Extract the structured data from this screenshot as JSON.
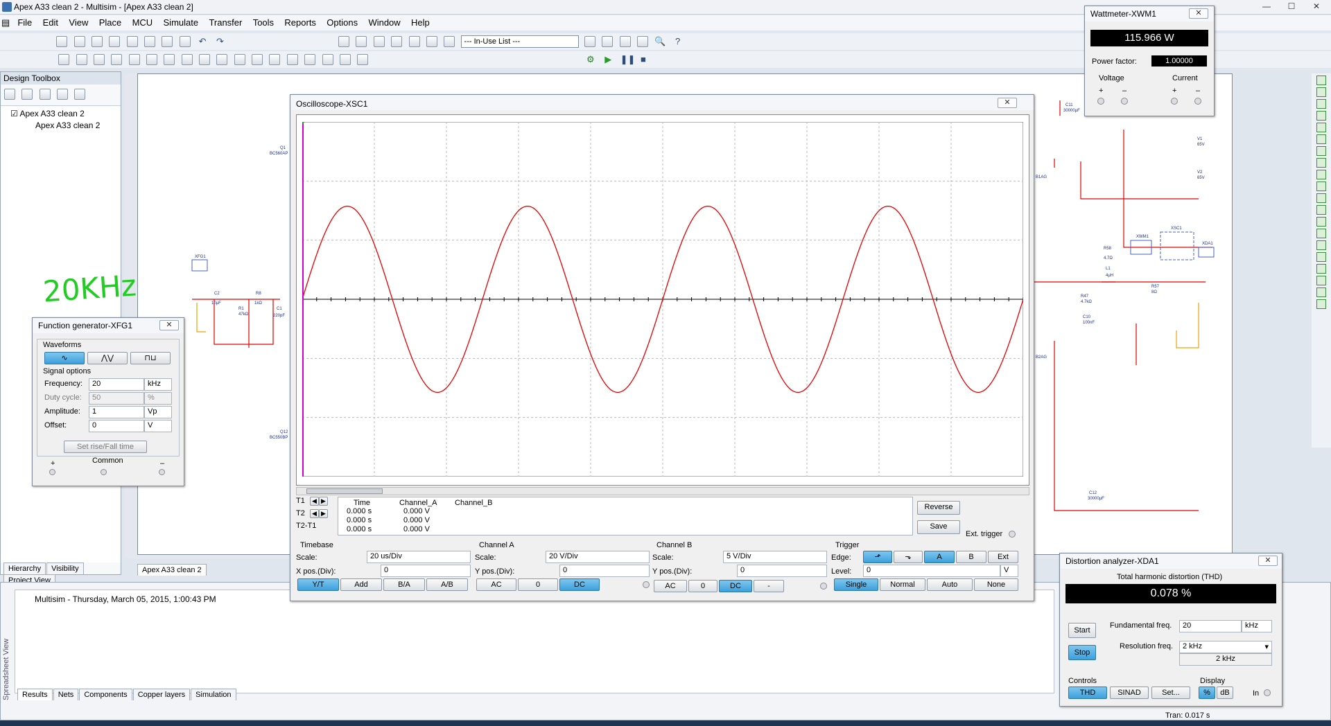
{
  "app": {
    "title": "Apex A33 clean 2 - Multisim - [Apex A33 clean 2]"
  },
  "menu": [
    "File",
    "Edit",
    "View",
    "Place",
    "MCU",
    "Simulate",
    "Transfer",
    "Tools",
    "Reports",
    "Options",
    "Window",
    "Help"
  ],
  "toolbar": {
    "in_use_list": "--- In-Use List ---"
  },
  "design_toolbox": {
    "title": "Design Toolbox",
    "root": "Apex A33 clean 2",
    "child": "Apex A33 clean 2",
    "tabs": [
      "Hierarchy",
      "Visibility",
      "Project View"
    ]
  },
  "document_tab": "Apex A33 clean 2",
  "annotation": "20KHz",
  "schematic_labels": {
    "q1": "Q1",
    "q1_type": "BC560AP",
    "q12": "Q12",
    "q12_type": "BC550BP",
    "xfg1": "XFG1",
    "c2": "C2",
    "c2_val": "10µF",
    "r1": "R1",
    "r1_val": "47kΩ",
    "r8": "R8",
    "r8_val": "1kΩ",
    "c1": "C1",
    "c1_val": "220pF",
    "c11": "C11",
    "c11_val": "30000µF",
    "v1": "V1",
    "v1_val": "65V",
    "v2": "V2",
    "v2_val": "65V",
    "net_a": "B1AG",
    "net_b": "B2AG",
    "r58": "R58",
    "r58_val": "4.7Ω",
    "l1": "L1",
    "l1_val": "4µH",
    "r47": "R47",
    "r47_val": "4.7kΩ",
    "c10": "C10",
    "c10_val": "100nF",
    "r57": "R57",
    "r57_val": "8Ω",
    "xwm1": "XWM1",
    "xsc1": "XSC1",
    "xda1": "XDA1",
    "c12": "C12",
    "c12_val": "30000µF"
  },
  "function_generator": {
    "title": "Function generator-XFG1",
    "waveforms_label": "Waveforms",
    "signal_options_label": "Signal options",
    "rows": [
      {
        "label": "Frequency:",
        "value": "20",
        "unit": "kHz"
      },
      {
        "label": "Duty cycle:",
        "value": "50",
        "unit": "%"
      },
      {
        "label": "Amplitude:",
        "value": "1",
        "unit": "Vp"
      },
      {
        "label": "Offset:",
        "value": "0",
        "unit": "V"
      }
    ],
    "rise_fall": "Set rise/Fall time",
    "plus": "+",
    "common": "Common",
    "minus": "–"
  },
  "oscilloscope": {
    "title": "Oscilloscope-XSC1",
    "cursor_headers": [
      "Time",
      "Channel_A",
      "Channel_B"
    ],
    "cursor_rows": [
      {
        "label": "T1",
        "time": "0.000 s",
        "cha": "0.000 V"
      },
      {
        "label": "T2",
        "time": "0.000 s",
        "cha": "0.000 V"
      },
      {
        "label": "T2-T1",
        "time": "0.000 s",
        "cha": "0.000 V"
      }
    ],
    "reverse": "Reverse",
    "save": "Save",
    "ext_trigger": "Ext. trigger",
    "timebase": {
      "label": "Timebase",
      "scale_label": "Scale:",
      "scale": "20 us/Div",
      "xpos_label": "X pos.(Div):",
      "xpos": "0",
      "buttons": [
        "Y/T",
        "Add",
        "B/A",
        "A/B"
      ]
    },
    "channel_a": {
      "label": "Channel A",
      "scale_label": "Scale:",
      "scale": "20  V/Div",
      "ypos_label": "Y pos.(Div):",
      "ypos": "0",
      "buttons": [
        "AC",
        "0",
        "DC"
      ]
    },
    "channel_b": {
      "label": "Channel B",
      "scale_label": "Scale:",
      "scale": "5  V/Div",
      "ypos_label": "Y pos.(Div):",
      "ypos": "0",
      "buttons": [
        "AC",
        "0",
        "DC",
        "-"
      ]
    },
    "trigger": {
      "label": "Trigger",
      "edge_label": "Edge:",
      "level_label": "Level:",
      "level": "0",
      "level_unit": "V",
      "edge_buttons": [
        "A",
        "B",
        "Ext"
      ],
      "mode_buttons": [
        "Single",
        "Normal",
        "Auto",
        "None"
      ]
    }
  },
  "chart_data": {
    "type": "line",
    "title": "",
    "xlabel": "",
    "ylabel": "",
    "x_divisions": 10,
    "y_divisions": 6,
    "xlim": [
      0,
      200
    ],
    "x_unit": "us",
    "ylim": [
      -60,
      60
    ],
    "y_unit": "V",
    "series": [
      {
        "channel": "A",
        "color": "#e60000",
        "frequency_khz": 20,
        "amplitude_v": 31.5,
        "phase_deg": 0
      }
    ],
    "grid": true
  },
  "wattmeter": {
    "title": "Wattmeter-XWM1",
    "reading": "115.966 W",
    "pf_label": "Power factor:",
    "pf": "1.00000",
    "voltage": "Voltage",
    "current": "Current",
    "plus": "+",
    "minus": "–"
  },
  "distortion": {
    "title": "Distortion analyzer-XDA1",
    "thd_label": "Total harmonic distortion (THD)",
    "reading": "0.078 %",
    "start": "Start",
    "stop": "Stop",
    "fund_label": "Fundamental freq.",
    "fund": "20",
    "fund_unit": "kHz",
    "res_label": "Resolution freq.",
    "res": "2 kHz",
    "res_echo": "2 kHz",
    "controls_label": "Controls",
    "display_label": "Display",
    "buttons": [
      "THD",
      "SINAD",
      "Set..."
    ],
    "display_buttons": [
      "%",
      "dB"
    ],
    "in": "In"
  },
  "spreadsheet": {
    "side_label": "Spreadsheet View",
    "message": "Multisim  -  Thursday, March 05, 2015, 1:00:43 PM",
    "tabs": [
      "Results",
      "Nets",
      "Components",
      "Copper layers",
      "Simulation"
    ]
  },
  "status": {
    "tran": "Tran: 0.017 s"
  }
}
